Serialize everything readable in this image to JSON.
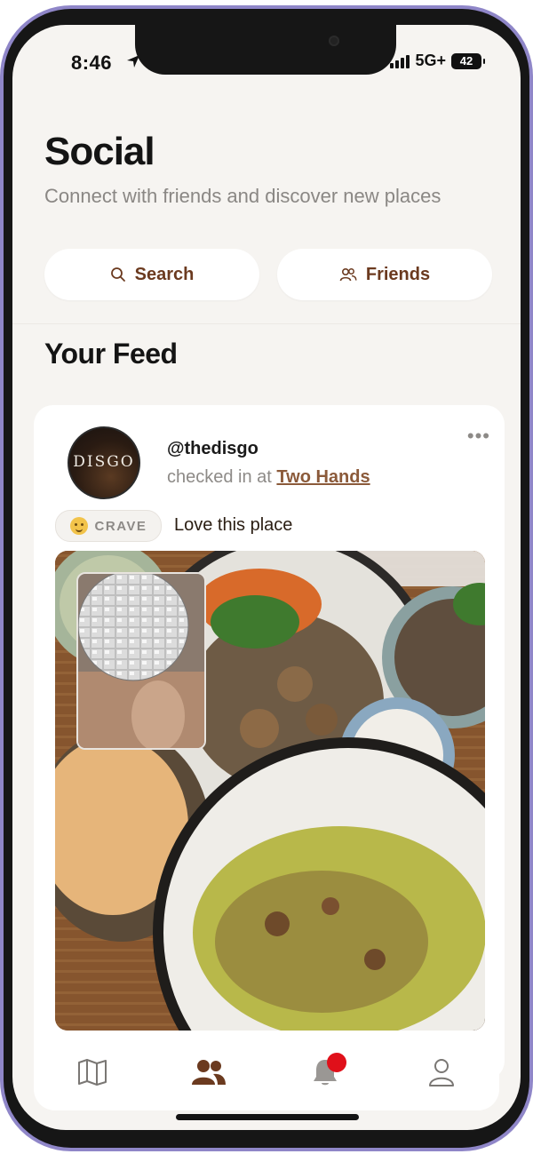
{
  "status_bar": {
    "time": "8:46",
    "network": "5G+",
    "battery": "42"
  },
  "header": {
    "title": "Social",
    "subtitle": "Connect with friends and discover new places"
  },
  "actions": {
    "search_label": "Search",
    "friends_label": "Friends"
  },
  "feed": {
    "title": "Your Feed",
    "posts": [
      {
        "avatar_text": "DISGO",
        "username": "@thedisgo",
        "checkin_prefix": "checked in at",
        "place": "Two Hands",
        "badge": "CRAVE",
        "caption": "Love this place"
      }
    ]
  },
  "tabbar": {
    "items": [
      "map-icon",
      "friends-icon",
      "bell-icon",
      "profile-icon"
    ],
    "active": "friends-icon",
    "notification_color": "#e0101a"
  },
  "colors": {
    "accent": "#6b3a1f",
    "link": "#8b5a3a",
    "background": "#f6f4f1",
    "frame": "#8f86c8"
  }
}
